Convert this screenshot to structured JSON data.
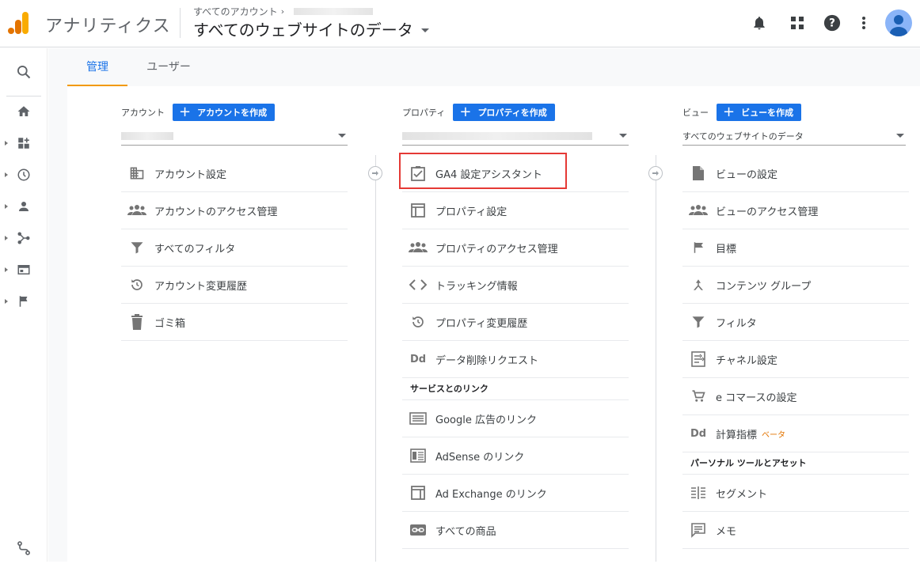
{
  "header": {
    "app_title": "アナリティクス",
    "breadcrumb": "すべてのアカウント",
    "view_title": "すべてのウェブサイトのデータ"
  },
  "tabs": [
    {
      "label": "管理",
      "active": true
    },
    {
      "label": "ユーザー",
      "active": false
    }
  ],
  "account": {
    "label": "アカウント",
    "create_label": "アカウントを作成",
    "items": [
      {
        "label": "アカウント設定",
        "icon": "building-icon"
      },
      {
        "label": "アカウントのアクセス管理",
        "icon": "people-icon"
      },
      {
        "label": "すべてのフィルタ",
        "icon": "filter-icon"
      },
      {
        "label": "アカウント変更履歴",
        "icon": "history-icon"
      },
      {
        "label": "ゴミ箱",
        "icon": "trash-icon"
      }
    ]
  },
  "property": {
    "label": "プロパティ",
    "create_label": "プロパティを作成",
    "items": [
      {
        "label": "GA4 設定アシスタント",
        "icon": "checkbox-icon"
      },
      {
        "label": "プロパティ設定",
        "icon": "layout-icon"
      },
      {
        "label": "プロパティのアクセス管理",
        "icon": "people-icon"
      },
      {
        "label": "トラッキング情報",
        "icon": "code-icon"
      },
      {
        "label": "プロパティ変更履歴",
        "icon": "history-icon"
      },
      {
        "label": "データ削除リクエスト",
        "icon": "dd-icon"
      }
    ],
    "links_section": "サービスとのリンク",
    "links": [
      {
        "label": "Google 広告のリンク",
        "icon": "ads-icon"
      },
      {
        "label": "AdSense のリンク",
        "icon": "adsense-icon"
      },
      {
        "label": "Ad Exchange のリンク",
        "icon": "adexchange-icon"
      },
      {
        "label": "すべての商品",
        "icon": "link-icon"
      }
    ]
  },
  "view": {
    "label": "ビュー",
    "create_label": "ビューを作成",
    "selected": "すべてのウェブサイトのデータ",
    "items": [
      {
        "label": "ビューの設定",
        "icon": "document-icon"
      },
      {
        "label": "ビューのアクセス管理",
        "icon": "people-icon"
      },
      {
        "label": "目標",
        "icon": "flag-icon"
      },
      {
        "label": "コンテンツ グループ",
        "icon": "content-group-icon"
      },
      {
        "label": "フィルタ",
        "icon": "filter-icon"
      },
      {
        "label": "チャネル設定",
        "icon": "channel-icon"
      },
      {
        "label": "e コマースの設定",
        "icon": "cart-icon"
      },
      {
        "label": "計算指標",
        "icon": "dd-icon",
        "badge": "ベータ"
      }
    ],
    "tools_section": "パーソナル ツールとアセット",
    "tools": [
      {
        "label": "セグメント",
        "icon": "segment-icon"
      },
      {
        "label": "メモ",
        "icon": "note-icon"
      }
    ]
  },
  "colors": {
    "accent": "#1a73e8",
    "tab_indicator": "#f29900",
    "highlight_box": "#e53935",
    "beta": "#e37400"
  }
}
